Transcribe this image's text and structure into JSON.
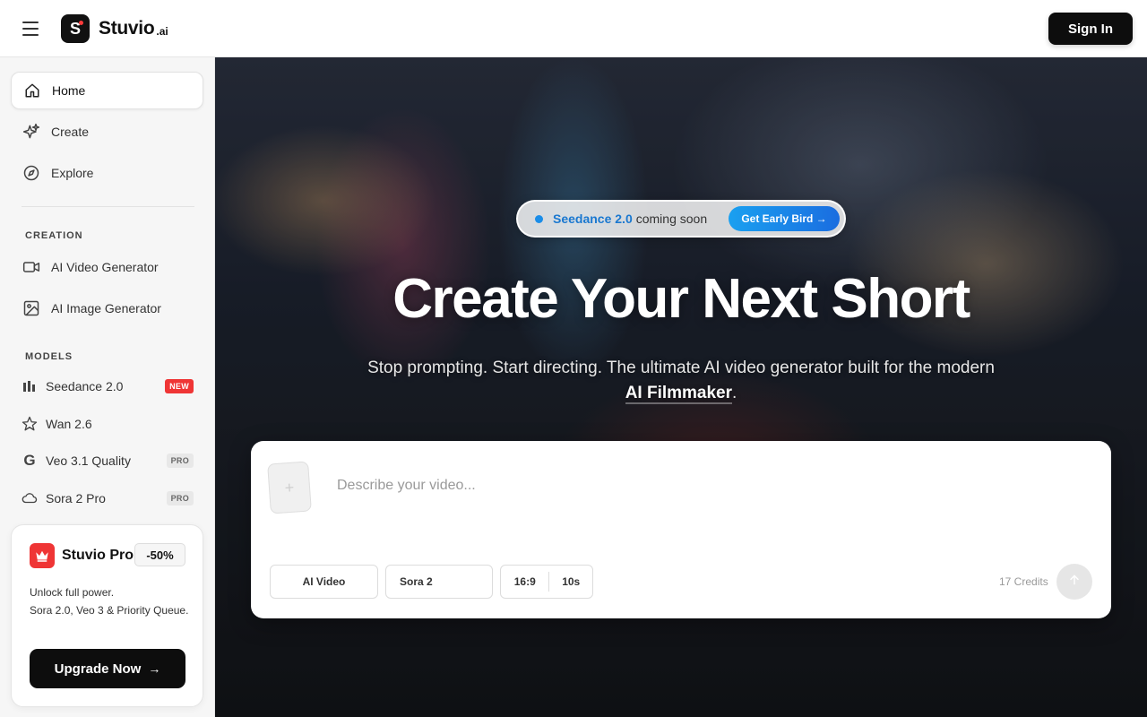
{
  "header": {
    "brand_name": "Stuvio",
    "brand_suffix": ".ai",
    "logo_letter": "S",
    "sign_in_label": "Sign In"
  },
  "sidebar": {
    "nav": [
      {
        "label": "Home",
        "icon": "home-icon",
        "active": true
      },
      {
        "label": "Create",
        "icon": "sparkle-icon",
        "active": false
      },
      {
        "label": "Explore",
        "icon": "compass-icon",
        "active": false
      }
    ],
    "creation_title": "CREATION",
    "creation": [
      {
        "label": "AI Video Generator",
        "icon": "video-camera-icon"
      },
      {
        "label": "AI Image Generator",
        "icon": "image-icon"
      }
    ],
    "models_title": "MODELS",
    "models": [
      {
        "label": "Seedance 2.0",
        "icon": "bars-icon",
        "badge": "NEW"
      },
      {
        "label": "Wan 2.6",
        "icon": "star-icon",
        "badge": ""
      },
      {
        "label": "Veo 3.1 Quality",
        "icon": "google-icon",
        "badge": "PRO"
      },
      {
        "label": "Sora 2 Pro",
        "icon": "cloud-icon",
        "badge": "PRO"
      }
    ],
    "promo": {
      "title": "Stuvio Pro",
      "discount": "-50%",
      "desc_line1": "Unlock full power.",
      "desc_line2": "Sora 2.0, Veo 3 & Priority Queue.",
      "button_label": "Upgrade Now",
      "button_arrow": "→"
    }
  },
  "hero": {
    "announce_strong": "Seedance 2.0",
    "announce_text": "coming soon",
    "announce_button": "Get Early Bird →",
    "title": "Create Your Next Short",
    "subtitle_main": "Stop prompting. Start directing. The ultimate AI video generator built for the modern",
    "subtitle_highlight": "AI Filmmaker",
    "subtitle_end": "."
  },
  "prompt": {
    "placeholder": "Describe your video...",
    "attach_symbol": "+",
    "type": "AI Video",
    "model": "Sora 2",
    "ratio": "16:9",
    "duration": "10s",
    "credits": "17 Credits"
  },
  "colors": {
    "accent_red": "#ef3535",
    "accent_blue": "#1a78d0",
    "dark": "#0d0d0d"
  }
}
